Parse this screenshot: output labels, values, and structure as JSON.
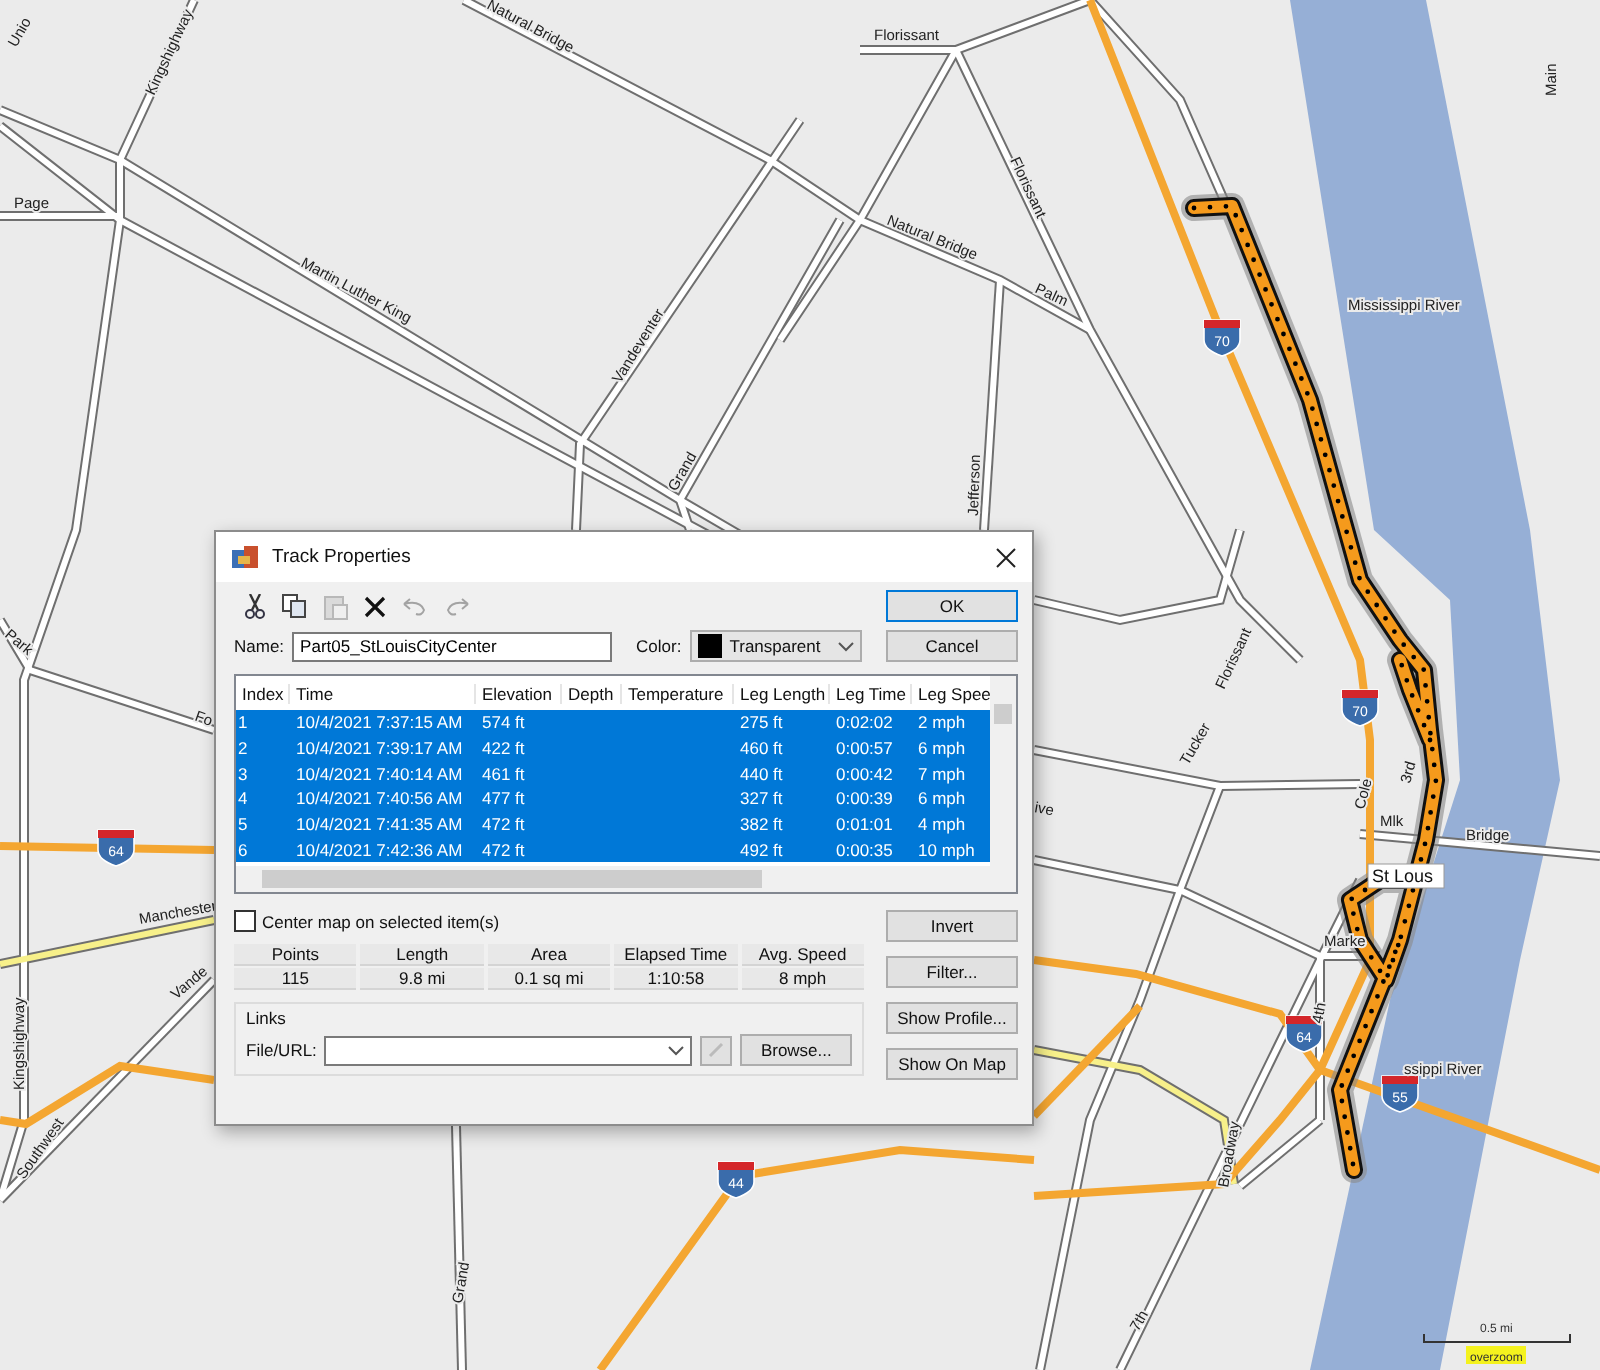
{
  "window": {
    "title": "Track Properties"
  },
  "toolbar": [
    {
      "kind": "cut",
      "disabled": false
    },
    {
      "kind": "copy",
      "disabled": false
    },
    {
      "kind": "paste",
      "disabled": true
    },
    {
      "kind": "delete",
      "disabled": false
    },
    {
      "kind": "undo",
      "disabled": true
    },
    {
      "kind": "redo",
      "disabled": true
    }
  ],
  "name_field": {
    "label": "Name:",
    "value": "Part05_StLouisCityCenter"
  },
  "color_field": {
    "label": "Color:",
    "value": "Transparent",
    "color": "#000000"
  },
  "top_buttons": [
    {
      "label": "OK",
      "default": true
    },
    {
      "label": "Cancel",
      "default": false
    }
  ],
  "table": {
    "columns": [
      "Index",
      "Time",
      "Elevation",
      "Depth",
      "Temperature",
      "Leg Length",
      "Leg Time",
      "Leg Spee"
    ],
    "rows": [
      {
        "selected": true,
        "cells": [
          "1",
          "10/4/2021 7:37:15 AM",
          "574 ft",
          "",
          "",
          "275 ft",
          "0:02:02",
          "2 mph"
        ]
      },
      {
        "selected": true,
        "cells": [
          "2",
          "10/4/2021 7:39:17 AM",
          "422 ft",
          "",
          "",
          "460 ft",
          "0:00:57",
          "6 mph"
        ]
      },
      {
        "selected": true,
        "cells": [
          "3",
          "10/4/2021 7:40:14 AM",
          "461 ft",
          "",
          "",
          "440 ft",
          "0:00:42",
          "7 mph"
        ]
      },
      {
        "selected": true,
        "cells": [
          "4",
          "10/4/2021 7:40:56 AM",
          "477 ft",
          "",
          "",
          "327 ft",
          "0:00:39",
          "6 mph"
        ]
      },
      {
        "selected": true,
        "cells": [
          "5",
          "10/4/2021 7:41:35 AM",
          "472 ft",
          "",
          "",
          "382 ft",
          "0:01:01",
          "4 mph"
        ]
      },
      {
        "selected": true,
        "cells": [
          "6",
          "10/4/2021 7:42:36 AM",
          "472 ft",
          "",
          "",
          "492 ft",
          "0:00:35",
          "10 mph"
        ]
      }
    ]
  },
  "center_map": {
    "label": "Center map on selected item(s)",
    "checked": false
  },
  "stats": {
    "columns": [
      "Points",
      "Length",
      "Area",
      "Elapsed Time",
      "Avg. Speed"
    ],
    "values": [
      "115",
      "9.8 mi",
      "0.1 sq mi",
      "1:10:58",
      "8 mph"
    ]
  },
  "side_buttons": [
    "Invert",
    "Filter...",
    "Show Profile...",
    "Show On Map"
  ],
  "links": {
    "title": "Links",
    "label": "File/URL:",
    "browse": "Browse..."
  },
  "map_labels": [
    {
      "text": "Unio"
    },
    {
      "text": "Kingshighway"
    },
    {
      "text": "Natural Bridge"
    },
    {
      "text": "Florissant"
    },
    {
      "text": "Page"
    },
    {
      "text": "Martin Luther King"
    },
    {
      "text": "Natural Bridge"
    },
    {
      "text": "Florissant"
    },
    {
      "text": "Palm"
    },
    {
      "text": "Vandeventer"
    },
    {
      "text": "Grand"
    },
    {
      "text": "Jefferson"
    },
    {
      "text": "Mississippi River"
    },
    {
      "text": "Main"
    },
    {
      "text": "Park"
    },
    {
      "text": "Kingshighway"
    },
    {
      "text": "Manchester"
    },
    {
      "text": "Southwest"
    },
    {
      "text": "Vande"
    },
    {
      "text": "Florissant"
    },
    {
      "text": "Tucker"
    },
    {
      "text": "Cole"
    },
    {
      "text": "3rd"
    },
    {
      "text": "Mlk"
    },
    {
      "text": "Bridge"
    },
    {
      "text": "St Lous"
    },
    {
      "text": "Marke"
    },
    {
      "text": "4th"
    },
    {
      "text": "ssippi River"
    },
    {
      "text": "Broadway"
    },
    {
      "text": "Grand"
    },
    {
      "text": "7th"
    },
    {
      "text": "Fo"
    },
    {
      "text": "ive"
    }
  ],
  "highway_shields": [
    {
      "number": "70"
    },
    {
      "number": "70"
    },
    {
      "number": "64"
    },
    {
      "number": "64"
    },
    {
      "number": "55"
    },
    {
      "number": "44"
    }
  ],
  "scale": {
    "distance": "0.5 mi",
    "mode": "overzoom"
  }
}
